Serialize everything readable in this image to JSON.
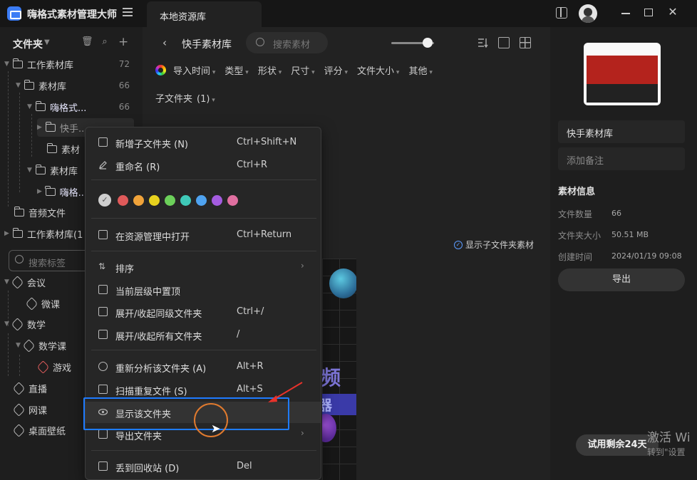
{
  "app": {
    "title": "嗨格式素材管理大师",
    "tab": "本地资源库"
  },
  "sidebar": {
    "header": "文件夹",
    "tree": [
      {
        "label": "工作素材库",
        "count": "72"
      },
      {
        "label": "素材库",
        "count": "66"
      },
      {
        "label": "嗨格式...",
        "count": "66"
      },
      {
        "label": "快手..."
      },
      {
        "label": "素材"
      },
      {
        "label": "素材库"
      },
      {
        "label": "嗨格..."
      },
      {
        "label": "音频文件"
      },
      {
        "label": "工作素材库(1"
      }
    ],
    "tag_search_placeholder": "搜索标签",
    "tags": [
      {
        "label": "会议"
      },
      {
        "label": "微课"
      },
      {
        "label": "数学"
      },
      {
        "label": "数学课"
      },
      {
        "label": "游戏"
      },
      {
        "label": "直播"
      },
      {
        "label": "网课"
      },
      {
        "label": "桌面壁纸"
      }
    ]
  },
  "main": {
    "breadcrumb_title": "快手素材库",
    "search_placeholder": "搜索素材",
    "filters": [
      "导入时间",
      "类型",
      "形状",
      "尺寸",
      "评分",
      "文件大小",
      "其他"
    ],
    "subfolder_label": "子文件夹",
    "subfolder_count": "(1)",
    "show_subfolder_assets": "显示子文件夹素材",
    "art_text_1": "频",
    "art_text_2": "器"
  },
  "context_menu": {
    "items": [
      {
        "label": "新增子文件夹 (N)",
        "shortcut": "Ctrl+Shift+N"
      },
      {
        "label": "重命名 (R)",
        "shortcut": "Ctrl+R"
      },
      {
        "label": "在资源管理中打开",
        "shortcut": "Ctrl+Return"
      },
      {
        "label": "排序",
        "shortcut": ""
      },
      {
        "label": "当前层级中置顶",
        "shortcut": ""
      },
      {
        "label": "展开/收起同级文件夹",
        "shortcut": "Ctrl+/"
      },
      {
        "label": "展开/收起所有文件夹",
        "shortcut": "/"
      },
      {
        "label": "重新分析该文件夹 (A)",
        "shortcut": "Alt+R"
      },
      {
        "label": "扫描重复文件 (S)",
        "shortcut": "Alt+S"
      },
      {
        "label": "显示该文件夹",
        "shortcut": ""
      },
      {
        "label": "导出文件夹",
        "shortcut": ""
      },
      {
        "label": "丢到回收站 (D)",
        "shortcut": "Del"
      }
    ],
    "colors": [
      "#e05a5a",
      "#f0a33a",
      "#e8d21e",
      "#6cd05a",
      "#3fc9b8",
      "#4fa3f0",
      "#a45ce0",
      "#e06fa0"
    ]
  },
  "right_panel": {
    "name": "快手素材库",
    "note_placeholder": "添加备注",
    "info_title": "素材信息",
    "info": [
      {
        "key": "文件数量",
        "value": "66"
      },
      {
        "key": "文件夹大小",
        "value": "50.51 MB"
      },
      {
        "key": "创建时间",
        "value": "2024/01/19 09:08"
      }
    ],
    "export_label": "导出"
  },
  "trial_badge": "试用剩余24天",
  "watermark": {
    "line1": "激活 Wi",
    "line2": "转到\"设置"
  }
}
